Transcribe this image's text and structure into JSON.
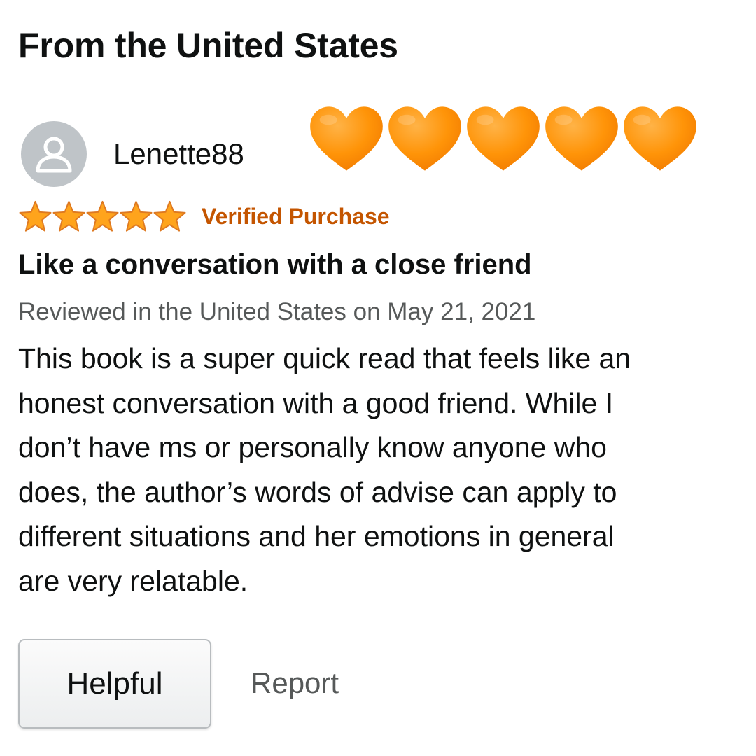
{
  "section": {
    "title": "From the United States"
  },
  "reviewer": {
    "name": "Lenette88",
    "avatar_icon": "user-silhouette-icon",
    "avatar_color": "#bfc4c8"
  },
  "reaction": {
    "icon": "orange-heart-icon",
    "count": 5,
    "color": "#ff8c00"
  },
  "rating": {
    "stars": 5,
    "max_stars": 5,
    "star_color": "#ffa41c",
    "verified_label": "Verified Purchase",
    "verified_color": "#c45500"
  },
  "review": {
    "title": "Like a conversation with a close friend",
    "date_line": "Reviewed in the United States on May 21, 2021",
    "body_lines": [
      "This book is a super quick read that feels like an",
      "honest conversation with a good friend. While I",
      "don’t have ms or personally know anyone who",
      "does, the author’s words of advise can apply to",
      "different situations and her emotions in general",
      "are very relatable."
    ]
  },
  "actions": {
    "helpful_label": "Helpful",
    "report_label": "Report"
  }
}
